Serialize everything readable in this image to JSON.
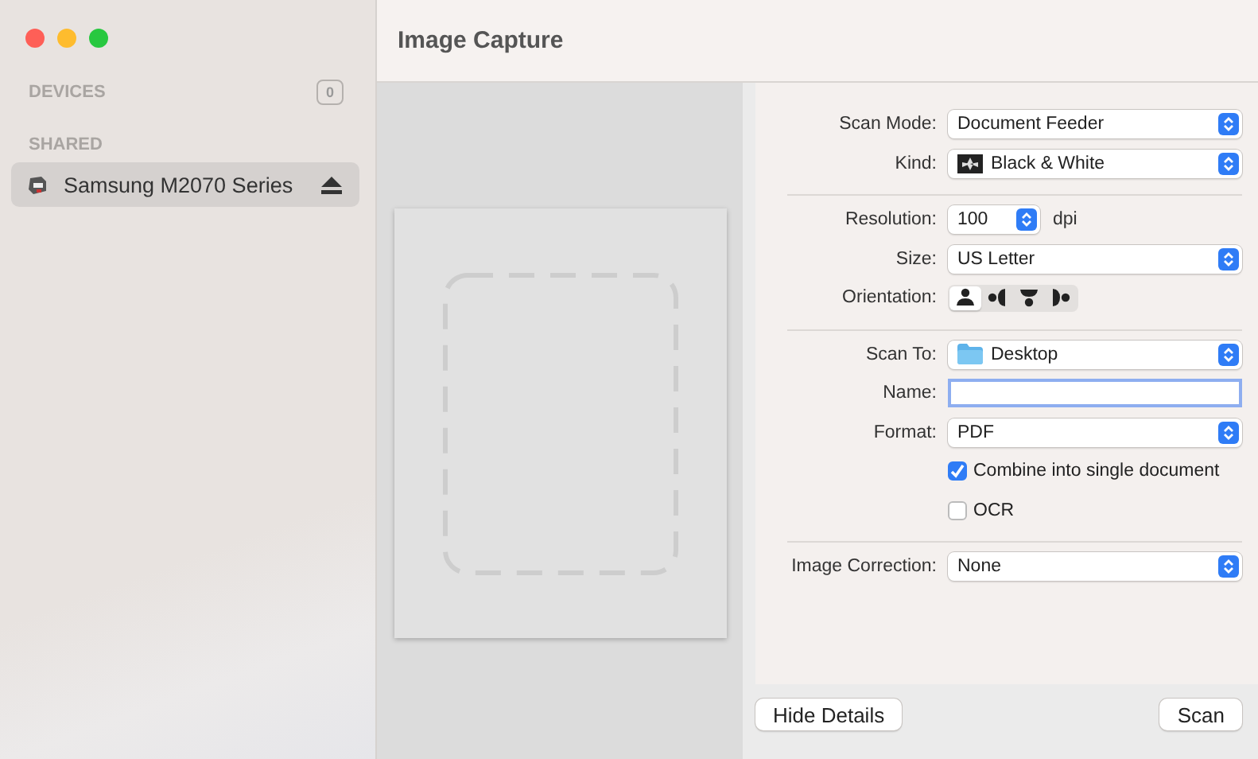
{
  "window": {
    "title": "Image Capture"
  },
  "sidebar": {
    "sections": [
      {
        "title": "DEVICES",
        "badge": "0"
      },
      {
        "title": "SHARED",
        "items": [
          {
            "name": "Samsung M2070 Series",
            "selected": true
          }
        ]
      }
    ]
  },
  "settings": {
    "groups": [
      [
        {
          "kind": "popup",
          "label": "Scan Mode:",
          "value": "Document Feeder"
        },
        {
          "kind": "picture-popup",
          "label": "Kind:",
          "value": "Black & White"
        }
      ],
      [
        {
          "kind": "stepper",
          "label": "Resolution:",
          "value": "100",
          "unit": "dpi"
        },
        {
          "kind": "popup",
          "label": "Size:",
          "value": "US Letter"
        },
        {
          "kind": "orientation",
          "label": "Orientation:",
          "options": [
            {
              "selected": true
            },
            {
              "selected": false
            },
            {
              "selected": false
            },
            {
              "selected": false
            }
          ]
        }
      ],
      [
        {
          "kind": "folder-popup",
          "label": "Scan To:",
          "value": "Desktop"
        },
        {
          "kind": "field",
          "label": "Name:",
          "focused": true
        },
        {
          "kind": "popup",
          "label": "Format:",
          "value": "PDF"
        },
        {
          "kind": "checkbox",
          "text": "Combine into single document",
          "checked": true
        },
        {
          "kind": "checkbox",
          "text": "OCR",
          "checked": false
        }
      ],
      [
        {
          "kind": "popup",
          "label": "Image Correction:",
          "value": "None"
        }
      ]
    ]
  },
  "buttons": {
    "left": "Hide Details",
    "right": "Scan"
  }
}
